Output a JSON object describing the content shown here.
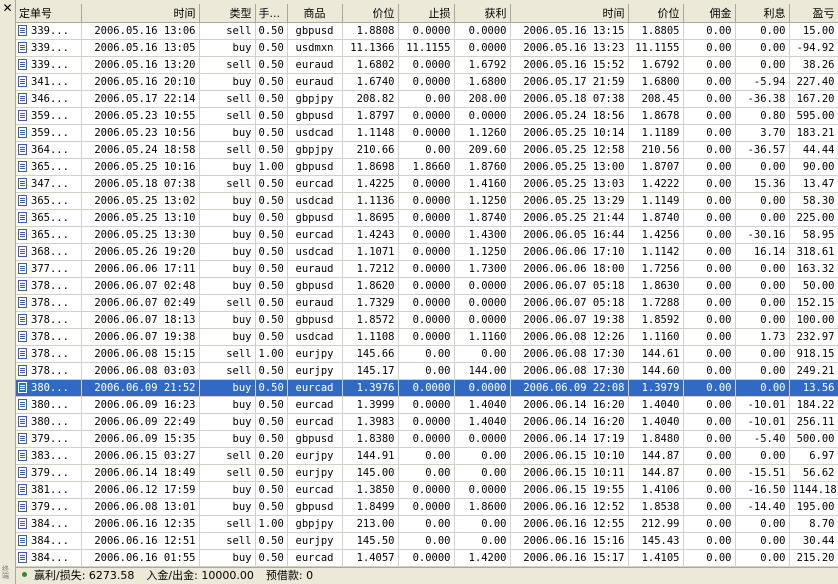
{
  "side": {
    "close_glyph": "✕",
    "label": "终端"
  },
  "columns": [
    "定单号",
    "时间",
    "类型",
    "手...",
    "商品",
    "价位",
    "止损",
    "获利",
    "时间",
    "价位",
    "佣金",
    "利息",
    "盈亏"
  ],
  "rows": [
    [
      "339...",
      "2006.05.16 13:06",
      "sell",
      "0.50",
      "gbpusd",
      "1.8808",
      "0.0000",
      "0.0000",
      "2006.05.16 13:15",
      "1.8805",
      "0.00",
      "0.00",
      "15.00"
    ],
    [
      "339...",
      "2006.05.16 13:05",
      "buy",
      "0.50",
      "usdmxn",
      "11.1366",
      "11.1155",
      "0.0000",
      "2006.05.16 13:23",
      "11.1155",
      "0.00",
      "0.00",
      "-94.92"
    ],
    [
      "339...",
      "2006.05.16 13:20",
      "sell",
      "0.50",
      "euraud",
      "1.6802",
      "0.0000",
      "1.6792",
      "2006.05.16 15:52",
      "1.6792",
      "0.00",
      "0.00",
      "38.26"
    ],
    [
      "341...",
      "2006.05.16 20:10",
      "buy",
      "0.50",
      "euraud",
      "1.6740",
      "0.0000",
      "1.6800",
      "2006.05.17 21:59",
      "1.6800",
      "0.00",
      "-5.94",
      "227.40"
    ],
    [
      "346...",
      "2006.05.17 22:14",
      "sell",
      "0.50",
      "gbpjpy",
      "208.82",
      "0.00",
      "208.00",
      "2006.05.18 07:38",
      "208.45",
      "0.00",
      "-36.38",
      "167.20"
    ],
    [
      "359...",
      "2006.05.23 10:55",
      "sell",
      "0.50",
      "gbpusd",
      "1.8797",
      "0.0000",
      "0.0000",
      "2006.05.24 18:56",
      "1.8678",
      "0.00",
      "0.80",
      "595.00"
    ],
    [
      "359...",
      "2006.05.23 10:56",
      "buy",
      "0.50",
      "usdcad",
      "1.1148",
      "0.0000",
      "1.1260",
      "2006.05.25 10:14",
      "1.1189",
      "0.00",
      "3.70",
      "183.21"
    ],
    [
      "364...",
      "2006.05.24 18:58",
      "sell",
      "0.50",
      "gbpjpy",
      "210.66",
      "0.00",
      "209.60",
      "2006.05.25 12:58",
      "210.56",
      "0.00",
      "-36.57",
      "44.44"
    ],
    [
      "365...",
      "2006.05.25 10:16",
      "buy",
      "1.00",
      "gbpusd",
      "1.8698",
      "1.8660",
      "1.8760",
      "2006.05.25 13:00",
      "1.8707",
      "0.00",
      "0.00",
      "90.00"
    ],
    [
      "347...",
      "2006.05.18 07:38",
      "sell",
      "0.50",
      "eurcad",
      "1.4225",
      "0.0000",
      "1.4160",
      "2006.05.25 13:03",
      "1.4222",
      "0.00",
      "15.36",
      "13.47"
    ],
    [
      "365...",
      "2006.05.25 13:02",
      "buy",
      "0.50",
      "usdcad",
      "1.1136",
      "0.0000",
      "1.1250",
      "2006.05.25 13:29",
      "1.1149",
      "0.00",
      "0.00",
      "58.30"
    ],
    [
      "365...",
      "2006.05.25 13:10",
      "buy",
      "0.50",
      "gbpusd",
      "1.8695",
      "0.0000",
      "1.8740",
      "2006.05.25 21:44",
      "1.8740",
      "0.00",
      "0.00",
      "225.00"
    ],
    [
      "365...",
      "2006.05.25 13:30",
      "buy",
      "0.50",
      "eurcad",
      "1.4243",
      "0.0000",
      "1.4300",
      "2006.06.05 16:44",
      "1.4256",
      "0.00",
      "-30.16",
      "58.95"
    ],
    [
      "368...",
      "2006.05.26 19:20",
      "buy",
      "0.50",
      "usdcad",
      "1.1071",
      "0.0000",
      "1.1250",
      "2006.06.06 17:10",
      "1.1142",
      "0.00",
      "16.14",
      "318.61"
    ],
    [
      "377...",
      "2006.06.06 17:11",
      "buy",
      "0.50",
      "euraud",
      "1.7212",
      "0.0000",
      "1.7300",
      "2006.06.06 18:00",
      "1.7256",
      "0.00",
      "0.00",
      "163.32"
    ],
    [
      "378...",
      "2006.06.07 02:48",
      "buy",
      "0.50",
      "gbpusd",
      "1.8620",
      "0.0000",
      "0.0000",
      "2006.06.07 05:18",
      "1.8630",
      "0.00",
      "0.00",
      "50.00"
    ],
    [
      "378...",
      "2006.06.07 02:49",
      "sell",
      "0.50",
      "euraud",
      "1.7329",
      "0.0000",
      "0.0000",
      "2006.06.07 05:18",
      "1.7288",
      "0.00",
      "0.00",
      "152.15"
    ],
    [
      "378...",
      "2006.06.07 18:13",
      "buy",
      "0.50",
      "gbpusd",
      "1.8572",
      "0.0000",
      "0.0000",
      "2006.06.07 19:38",
      "1.8592",
      "0.00",
      "0.00",
      "100.00"
    ],
    [
      "378...",
      "2006.06.07 19:38",
      "buy",
      "0.50",
      "usdcad",
      "1.1108",
      "0.0000",
      "1.1160",
      "2006.06.08 12:26",
      "1.1160",
      "0.00",
      "1.73",
      "232.97"
    ],
    [
      "378...",
      "2006.06.08 15:15",
      "sell",
      "1.00",
      "eurjpy",
      "145.66",
      "0.00",
      "0.00",
      "2006.06.08 17:30",
      "144.61",
      "0.00",
      "0.00",
      "918.15"
    ],
    [
      "378...",
      "2006.06.08 03:03",
      "sell",
      "0.50",
      "eurjpy",
      "145.17",
      "0.00",
      "144.00",
      "2006.06.08 17:30",
      "144.60",
      "0.00",
      "0.00",
      "249.21"
    ],
    [
      "380...",
      "2006.06.09 21:52",
      "buy",
      "0.50",
      "eurcad",
      "1.3976",
      "0.0000",
      "0.0000",
      "2006.06.09 22:08",
      "1.3979",
      "0.00",
      "0.00",
      "13.56"
    ],
    [
      "380...",
      "2006.06.09 16:23",
      "buy",
      "0.50",
      "eurcad",
      "1.3999",
      "0.0000",
      "1.4040",
      "2006.06.14 16:20",
      "1.4040",
      "0.00",
      "-10.01",
      "184.22"
    ],
    [
      "380...",
      "2006.06.09 22:49",
      "buy",
      "0.50",
      "eurcad",
      "1.3983",
      "0.0000",
      "1.4040",
      "2006.06.14 16:20",
      "1.4040",
      "0.00",
      "-10.01",
      "256.11"
    ],
    [
      "379...",
      "2006.06.09 15:35",
      "buy",
      "0.50",
      "gbpusd",
      "1.8380",
      "0.0000",
      "0.0000",
      "2006.06.14 17:19",
      "1.8480",
      "0.00",
      "-5.40",
      "500.00"
    ],
    [
      "383...",
      "2006.06.15 03:27",
      "sell",
      "0.20",
      "eurjpy",
      "144.91",
      "0.00",
      "0.00",
      "2006.06.15 10:10",
      "144.87",
      "0.00",
      "0.00",
      "6.97"
    ],
    [
      "379...",
      "2006.06.14 18:49",
      "sell",
      "0.50",
      "eurjpy",
      "145.00",
      "0.00",
      "0.00",
      "2006.06.15 10:11",
      "144.87",
      "0.00",
      "-15.51",
      "56.62"
    ],
    [
      "381...",
      "2006.06.12 17:59",
      "buy",
      "0.50",
      "eurcad",
      "1.3850",
      "0.0000",
      "0.0000",
      "2006.06.15 19:55",
      "1.4106",
      "0.00",
      "-16.50",
      "1144.18"
    ],
    [
      "379...",
      "2006.06.08 13:01",
      "buy",
      "0.50",
      "gbpusd",
      "1.8499",
      "0.0000",
      "1.8600",
      "2006.06.16 12:52",
      "1.8538",
      "0.00",
      "-14.40",
      "195.00"
    ],
    [
      "384...",
      "2006.06.16 12:35",
      "sell",
      "1.00",
      "gbpjpy",
      "213.00",
      "0.00",
      "0.00",
      "2006.06.16 12:55",
      "212.99",
      "0.00",
      "0.00",
      "8.70"
    ],
    [
      "384...",
      "2006.06.16 12:51",
      "sell",
      "0.50",
      "eurjpy",
      "145.50",
      "0.00",
      "0.00",
      "2006.06.16 15:16",
      "145.43",
      "0.00",
      "0.00",
      "30.44"
    ],
    [
      "384...",
      "2006.06.16 01:55",
      "buy",
      "0.50",
      "eurcad",
      "1.4057",
      "0.0000",
      "1.4200",
      "2006.06.16 15:17",
      "1.4105",
      "0.00",
      "0.00",
      "215.20"
    ]
  ],
  "selected_row": 21,
  "status": {
    "pl_label": "赢利/损失:",
    "pl_value": "6273.58",
    "deposit_label": "入金/出金:",
    "deposit_value": "10000.00",
    "credit_label": "预借款:",
    "credit_value": "0"
  },
  "colors": {
    "selection": "#316ac5",
    "panel": "#ece9d8",
    "status_dot": "#2e8b2e"
  }
}
